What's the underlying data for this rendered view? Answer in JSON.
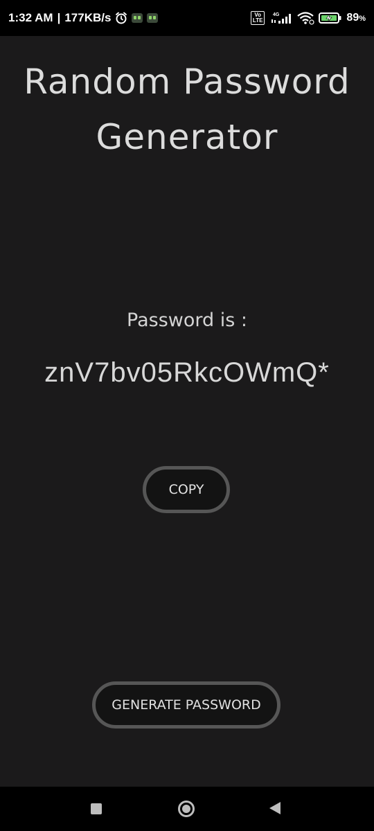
{
  "status_bar": {
    "time": "1:32 AM",
    "separator": "|",
    "network_speed": "177KB/s",
    "network_type": "4G",
    "volte_top": "Vo",
    "volte_bottom": "LTE",
    "battery_percent": "89",
    "battery_unit": "%",
    "icons": [
      "alarm-icon",
      "app-notification-icon",
      "app-notification-icon",
      "volte-icon",
      "signal-icon",
      "wifi-icon",
      "battery-charging-icon"
    ]
  },
  "app": {
    "title_line1": "Random Password",
    "title_line2": "Generator",
    "password_label": "Password is :",
    "password_value": "znV7bv05RkcOWmQ*",
    "copy_label": "COPY",
    "generate_label": "GENERATE PASSWORD"
  },
  "nav_bar": {
    "icons": [
      "recent-apps-icon",
      "home-icon",
      "back-icon"
    ]
  },
  "colors": {
    "background": "#1b1a1b",
    "button_fill": "#131313",
    "button_border": "#565656",
    "text": "#dcdcdc"
  }
}
